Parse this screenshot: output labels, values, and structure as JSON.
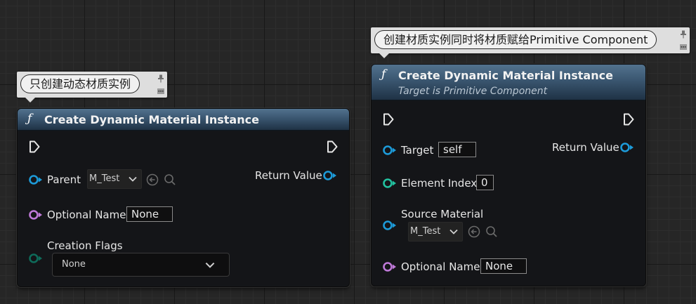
{
  "comments": [
    {
      "text": "只创建动态材质实例"
    },
    {
      "text": "创建材质实例同时将材质赋给Primitive Component"
    }
  ],
  "node_left": {
    "function_icon": "function-icon",
    "title": "Create Dynamic Material Instance",
    "return_label": "Return Value",
    "parent_label": "Parent",
    "parent_value": "M_Test",
    "optional_name_label": "Optional Name",
    "optional_name_value": "None",
    "creation_flags_label": "Creation Flags",
    "creation_flags_value": "None"
  },
  "node_right": {
    "function_icon": "function-icon",
    "title": "Create Dynamic Material Instance",
    "subtitle": "Target is Primitive Component",
    "return_label": "Return Value",
    "target_label": "Target",
    "target_value": "self",
    "element_index_label": "Element Index",
    "element_index_value": "0",
    "source_material_label": "Source Material",
    "source_material_value": "M_Test",
    "optional_name_label": "Optional Name",
    "optional_name_value": "None"
  },
  "colors": {
    "object_pin": "#1d9bd9",
    "name_pin": "#c07ad9",
    "int_pin": "#22c2a0",
    "enum_pin": "#0e6b5a",
    "header": "#3a5670",
    "exec": "#e6e6e6"
  }
}
